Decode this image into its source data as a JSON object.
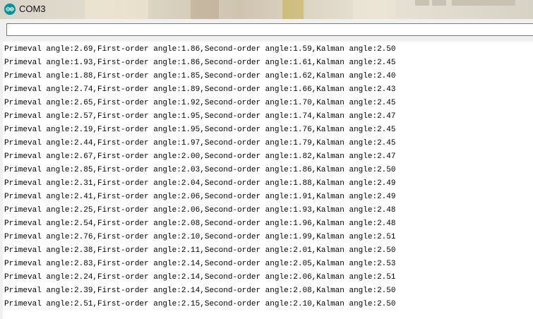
{
  "window": {
    "title": "COM3",
    "app_icon": "arduino-icon",
    "accent_color": "#00979c"
  },
  "command_input": {
    "value": ""
  },
  "serial_output": {
    "lines": [
      "Primeval angle:2.69,First-order angle:1.86,Second-order angle:1.59,Kalman angle:2.50",
      "Primeval angle:1.93,First-order angle:1.86,Second-order angle:1.61,Kalman angle:2.45",
      "Primeval angle:1.88,First-order angle:1.85,Second-order angle:1.62,Kalman angle:2.40",
      "Primeval angle:2.74,First-order angle:1.89,Second-order angle:1.66,Kalman angle:2.43",
      "Primeval angle:2.65,First-order angle:1.92,Second-order angle:1.70,Kalman angle:2.45",
      "Primeval angle:2.57,First-order angle:1.95,Second-order angle:1.74,Kalman angle:2.47",
      "Primeval angle:2.19,First-order angle:1.95,Second-order angle:1.76,Kalman angle:2.45",
      "Primeval angle:2.44,First-order angle:1.97,Second-order angle:1.79,Kalman angle:2.45",
      "Primeval angle:2.67,First-order angle:2.00,Second-order angle:1.82,Kalman angle:2.47",
      "Primeval angle:2.85,First-order angle:2.03,Second-order angle:1.86,Kalman angle:2.50",
      "Primeval angle:2.31,First-order angle:2.04,Second-order angle:1.88,Kalman angle:2.49",
      "Primeval angle:2.41,First-order angle:2.06,Second-order angle:1.91,Kalman angle:2.49",
      "Primeval angle:2.25,First-order angle:2.06,Second-order angle:1.93,Kalman angle:2.48",
      "Primeval angle:2.54,First-order angle:2.08,Second-order angle:1.96,Kalman angle:2.48",
      "Primeval angle:2.76,First-order angle:2.10,Second-order angle:1.99,Kalman angle:2.51",
      "Primeval angle:2.38,First-order angle:2.11,Second-order angle:2.01,Kalman angle:2.50",
      "Primeval angle:2.83,First-order angle:2.14,Second-order angle:2.05,Kalman angle:2.53",
      "Primeval angle:2.24,First-order angle:2.14,Second-order angle:2.06,Kalman angle:2.51",
      "Primeval angle:2.39,First-order angle:2.14,Second-order angle:2.08,Kalman angle:2.50",
      "Primeval angle:2.51,First-order angle:2.15,Second-order angle:2.10,Kalman angle:2.50"
    ]
  }
}
